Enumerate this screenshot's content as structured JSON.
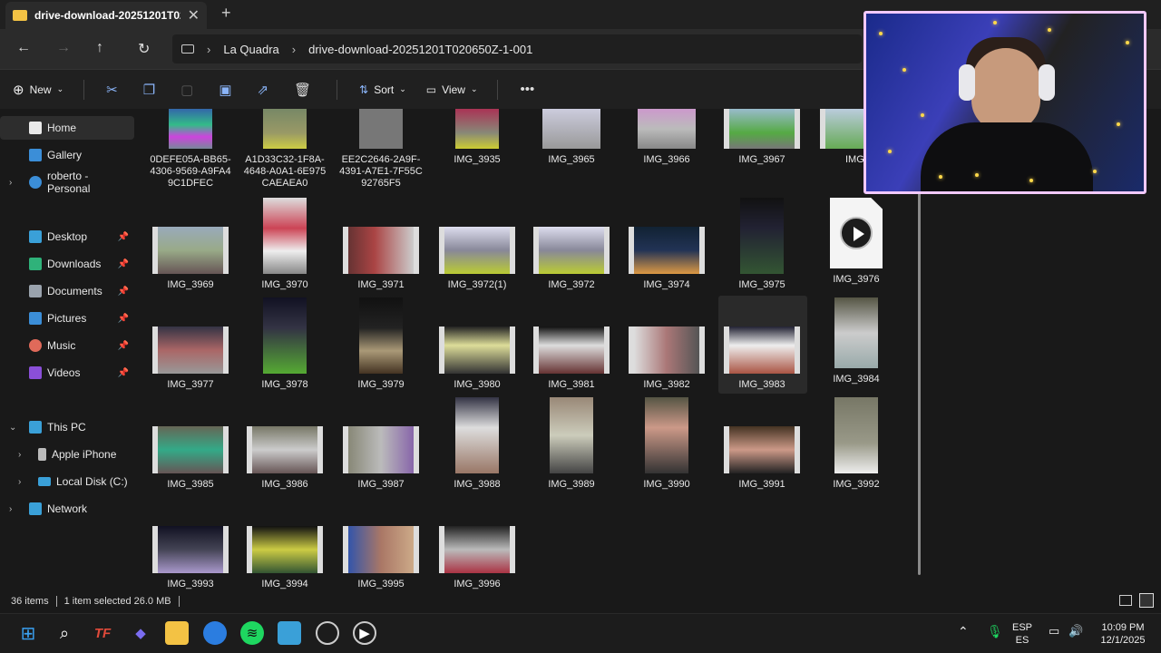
{
  "window": {
    "tab_title": "drive-download-20251201T02",
    "breadcrumb": [
      "La Quadra",
      "drive-download-20251201T020650Z-1-001"
    ]
  },
  "toolbar": {
    "new_label": "New",
    "sort_label": "Sort",
    "view_label": "View"
  },
  "sidebar": {
    "home": "Home",
    "gallery": "Gallery",
    "onedrive": "roberto - Personal",
    "desktop": "Desktop",
    "downloads": "Downloads",
    "documents": "Documents",
    "pictures": "Pictures",
    "music": "Music",
    "videos": "Videos",
    "thispc": "This PC",
    "iphone": "Apple iPhone",
    "localdisk": "Local Disk (C:)",
    "network": "Network"
  },
  "files": {
    "r0": [
      "0DEFE05A-BB65-4306-9569-A9FA49C1DFEC",
      "A1D33C32-1F8A-4648-A0A1-6E975CAEAEA0",
      "EE2C2646-2A9F-4391-A7E1-7F55C92765F5",
      "IMG_3935",
      "IMG_3965",
      "IMG_3966",
      "IMG_3967",
      "IMG_3"
    ],
    "r1": [
      "IMG_3969",
      "IMG_3970",
      "IMG_3971",
      "IMG_3972(1)",
      "IMG_3972",
      "IMG_3974",
      "IMG_3975",
      "IMG_3976"
    ],
    "r2": [
      "IMG_3977",
      "IMG_3978",
      "IMG_3979",
      "IMG_3980",
      "IMG_3981",
      "IMG_3982",
      "IMG_3983",
      "IMG_3984"
    ],
    "r3": [
      "IMG_3985",
      "IMG_3986",
      "IMG_3987",
      "IMG_3988",
      "IMG_3989",
      "IMG_3990",
      "IMG_3991",
      "IMG_3992"
    ],
    "r4": [
      "IMG_3993",
      "IMG_3994",
      "IMG_3995",
      "IMG_3996"
    ]
  },
  "status": {
    "items": "36 items",
    "selected": "1 item selected  26.0 MB"
  },
  "tray": {
    "lang1": "ESP",
    "lang2": "ES",
    "time": "10:09 PM",
    "date": "12/1/2025"
  }
}
